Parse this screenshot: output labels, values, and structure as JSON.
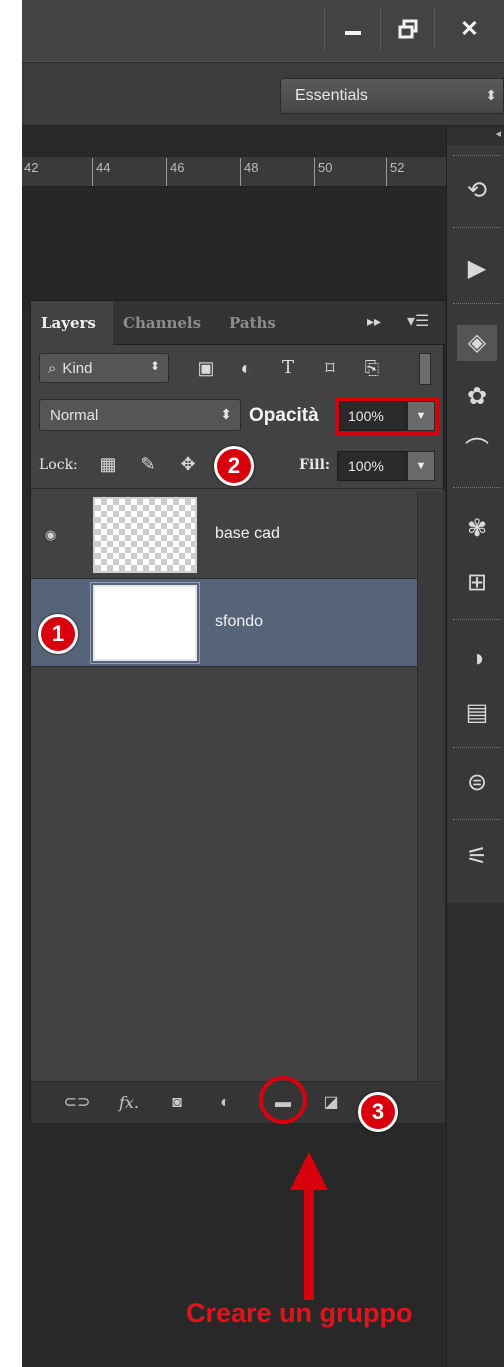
{
  "window": {
    "controls": {
      "minimize_icon": "minimize-icon",
      "restore_icon": "restore-icon",
      "close_icon": "close-icon"
    },
    "close_glyph": "✕"
  },
  "options_bar": {
    "workspace": "Essentials"
  },
  "ruler": {
    "ticks": [
      "42",
      "44",
      "46",
      "48",
      "50",
      "52"
    ]
  },
  "layers_panel": {
    "tabs": [
      "Layers",
      "Channels",
      "Paths"
    ],
    "filter": {
      "kind_label": "Kind"
    },
    "blend_mode": "Normal",
    "opacity_label": "Opacità",
    "opacity_value": "100%",
    "lock_label": "Lock:",
    "fill_label": "Fill:",
    "fill_value": "100%",
    "layers": [
      {
        "name": "base cad",
        "visible": true,
        "selected": false,
        "thumb": "transparent"
      },
      {
        "name": "sfondo",
        "visible": false,
        "selected": true,
        "thumb": "white"
      }
    ],
    "footer_icons": [
      "link-icon",
      "fx-icon",
      "mask-icon",
      "adjustment-icon",
      "new-group-icon",
      "new-layer-icon"
    ],
    "fx_text": "fx."
  },
  "markers": [
    "1",
    "2",
    "3"
  ],
  "annotation": {
    "caption": "Creare un gruppo"
  },
  "colors": {
    "accent_red": "#d8000c",
    "selected_row": "#566378",
    "panel_bg": "#424242"
  }
}
